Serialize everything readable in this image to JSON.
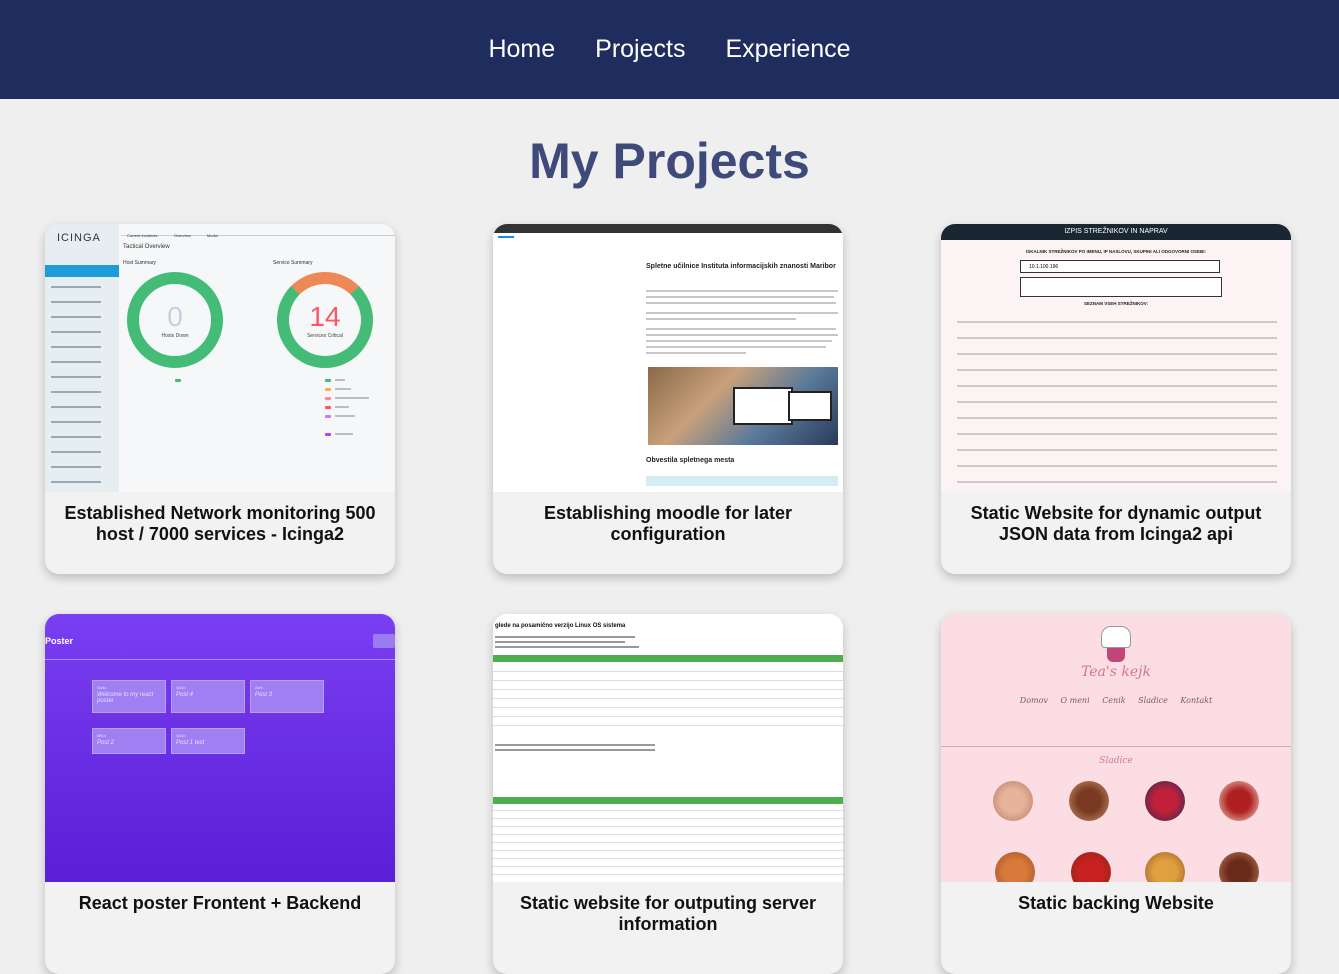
{
  "nav": {
    "items": [
      {
        "label": "Home"
      },
      {
        "label": "Projects"
      },
      {
        "label": "Experience"
      }
    ]
  },
  "page": {
    "title": "My Projects"
  },
  "projects": [
    {
      "caption": "Established Network monitoring 500 host / 7000 services - Icinga2"
    },
    {
      "caption": "Establishing moodle for later configuration"
    },
    {
      "caption": "Static Website for dynamic output JSON data from Icinga2 api"
    },
    {
      "caption": "React poster Frontent + Backend"
    },
    {
      "caption": "Static website for outputing server information"
    },
    {
      "caption": "Static backing Website"
    }
  ],
  "thumbs": {
    "icinga": {
      "logo": "icinga",
      "tabs": [
        "Current Incidents",
        "Overview",
        "Modul"
      ],
      "heading": "Tactical Overview",
      "host_summary": "Host Summary",
      "service_summary": "Service Summary",
      "hosts_down_value": "0",
      "hosts_down_label": "Hosts Down",
      "services_critical_value": "14",
      "services_critical_label": "Services Critical",
      "legend": [
        "OK",
        "Warning",
        "Critical (Handled)",
        "Critical",
        "Unknown (Handled)",
        "Unknown"
      ]
    },
    "moodle": {
      "heading": "Spletne učilnice Instituta informacijskih znanosti Maribor",
      "section": "Obvestila spletnega mesta"
    },
    "json": {
      "header": "IZPIS STREŽNIKOV IN NAPRAV",
      "search_label": "ISKALNIK STREŽNIKOV PO IMENU, IP NASLOVU, SKUPINI ALI ODGOVORNI OSEBI:",
      "search_value": "10.1.100.196",
      "list_label": "SEZNAM VSEH STREŽNIKOV:"
    },
    "poster": {
      "title": "Poster",
      "notes": [
        {
          "user": "Gašo",
          "text": "Welcome to my react poster"
        },
        {
          "user": "Gašo",
          "text": "Post 4"
        },
        {
          "user": "Aleš",
          "text": "Post 3"
        },
        {
          "user": "Miha",
          "text": "Post 2"
        },
        {
          "user": "Gašo",
          "text": "Post 1 test"
        }
      ]
    },
    "server": {
      "heading": "glede na posamično verzijo Linux OS sistema"
    },
    "baking": {
      "brand": "Tea's kejk",
      "menu": [
        "Domov",
        "O meni",
        "Cenik",
        "Sladice",
        "Kontakt"
      ],
      "section": "Sladice"
    }
  }
}
